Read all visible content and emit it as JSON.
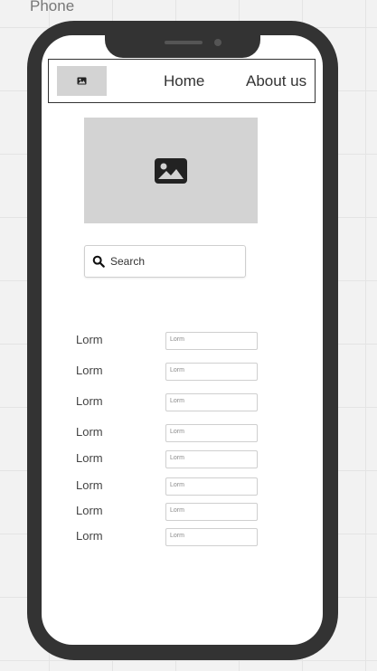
{
  "frame": {
    "title": "Phone"
  },
  "navbar": {
    "logo_icon": "image-icon",
    "links": [
      {
        "label": "Home"
      },
      {
        "label": "About us"
      }
    ]
  },
  "hero": {
    "icon": "image-icon"
  },
  "search": {
    "icon": "search-icon",
    "label": "Search"
  },
  "form": {
    "rows": [
      {
        "label": "Lorm",
        "value": "Lorm"
      },
      {
        "label": "Lorm",
        "value": "Lorm"
      },
      {
        "label": "Lorm",
        "value": "Lorm"
      },
      {
        "label": "Lorm",
        "value": "Lorm"
      },
      {
        "label": "Lorm",
        "value": "Lorm"
      },
      {
        "label": "Lorm",
        "value": "Lorm"
      },
      {
        "label": "Lorm",
        "value": "Lorm"
      },
      {
        "label": "Lorm",
        "value": "Lorm"
      }
    ]
  },
  "colors": {
    "phone_body": "#333333",
    "placeholder_fill": "#d3d3d3",
    "canvas_background": "#f2f2f2"
  }
}
